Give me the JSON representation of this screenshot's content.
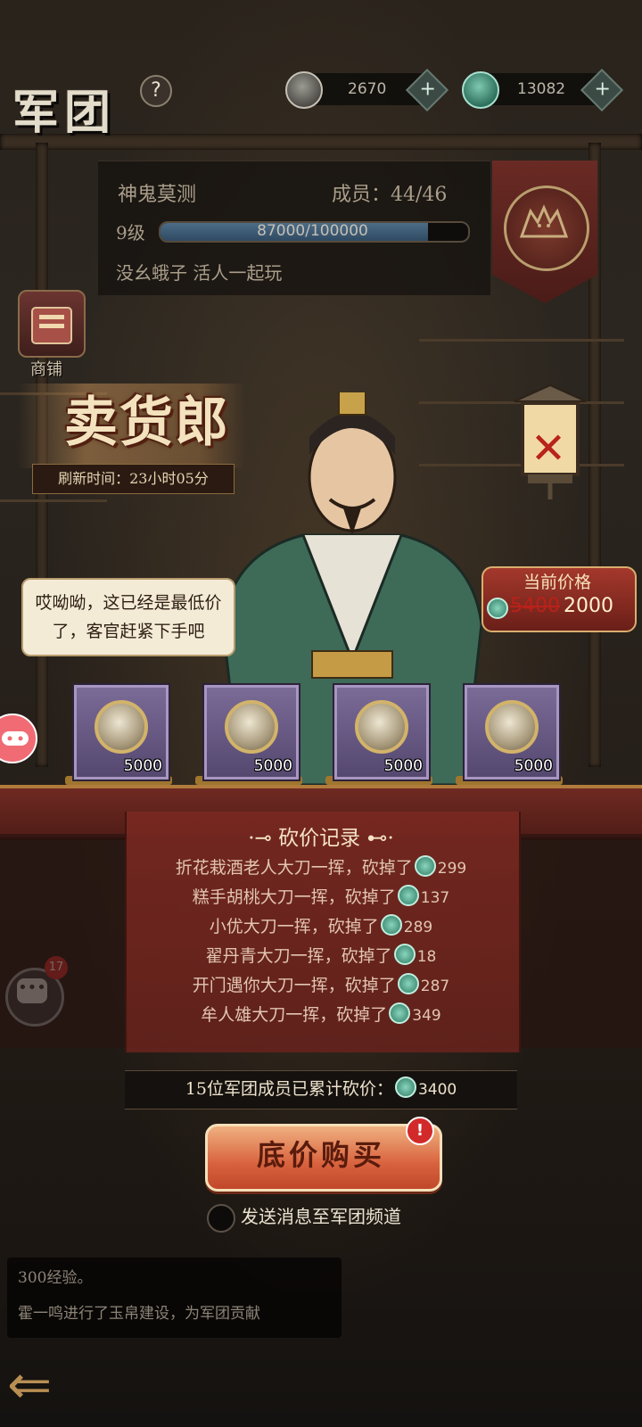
{
  "header": {
    "title": "军团",
    "help_icon": "?",
    "currencies": [
      {
        "name": "silver-coin",
        "value": "2670",
        "plus": "+"
      },
      {
        "name": "jade",
        "value": "13082",
        "plus": "+"
      }
    ]
  },
  "legion": {
    "name": "神鬼莫测",
    "members_label": "成员：44/46",
    "level": "9级",
    "exp_text": "87000/100000",
    "exp_progress": 0.87,
    "motto": "没幺蛾子 活人一起玩"
  },
  "shop": {
    "label": "商铺"
  },
  "merchant": {
    "title": "卖货郎",
    "refresh": "刷新时间：23小时05分",
    "speech": "哎呦呦，这已经是最低价了，客官赶紧下手吧"
  },
  "price": {
    "label": "当前价格",
    "old": "5400",
    "new": "2000"
  },
  "items": [
    {
      "count": "5000"
    },
    {
      "count": "5000"
    },
    {
      "count": "5000"
    },
    {
      "count": "5000"
    }
  ],
  "record": {
    "title": "砍价记录",
    "rows": [
      {
        "text": "折花栽酒老人大刀一挥，砍掉了",
        "amount": "299"
      },
      {
        "text": "糕手胡桃大刀一挥，砍掉了",
        "amount": "137"
      },
      {
        "text": "小优大刀一挥，砍掉了",
        "amount": "289"
      },
      {
        "text": "翟丹青大刀一挥，砍掉了",
        "amount": "18"
      },
      {
        "text": "开门遇你大刀一挥，砍掉了",
        "amount": "287"
      },
      {
        "text": "牟人雄大刀一挥，砍掉了",
        "amount": "349"
      }
    ],
    "total_text": "15位军团成员已累计砍价：",
    "total_amount": "3400"
  },
  "buy": {
    "label": "底价购买",
    "alert": "!"
  },
  "send": {
    "label": "发送消息至军团频道"
  },
  "chat": {
    "badge": "17"
  },
  "log": {
    "lines": [
      "300经验。",
      "霍一鸣进行了玉帛建设，为军团贡献"
    ]
  },
  "colors": {
    "accent_red": "#b8221a",
    "price_new": "#fff0cf",
    "item_card": "#7a6b97"
  }
}
